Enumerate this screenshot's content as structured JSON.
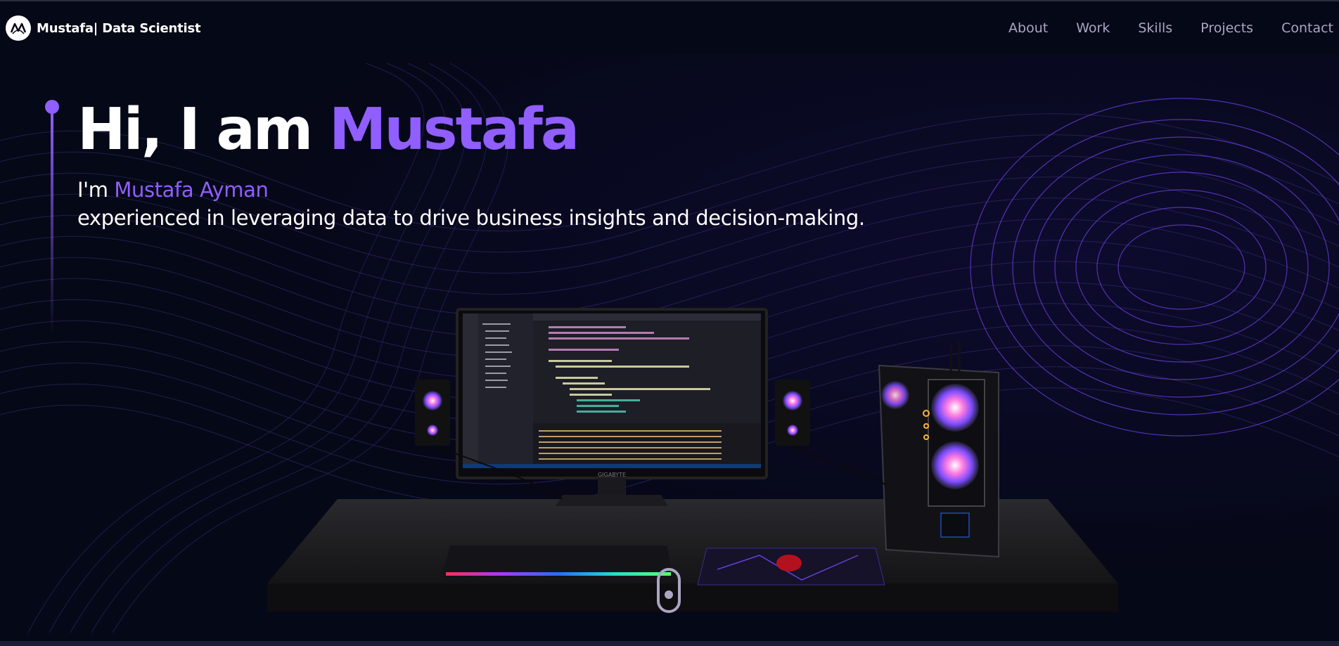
{
  "navbar": {
    "logo_icon": "logo-icon",
    "brand": "Mustafa| Data Scientist",
    "links": [
      "About",
      "Work",
      "Skills",
      "Projects",
      "Contact"
    ]
  },
  "hero": {
    "title_prefix": "Hi, I am ",
    "title_name": "Mustafa",
    "sub_prefix": "I'm ",
    "sub_name": "Mustafa Ayman",
    "sub_line2": "experienced in leveraging data to drive business insights and decision-making."
  },
  "monitor_brand": "GIGABYTE",
  "colors": {
    "accent": "#915eff",
    "background": "#050816",
    "nav_text": "#aaa6c3"
  }
}
